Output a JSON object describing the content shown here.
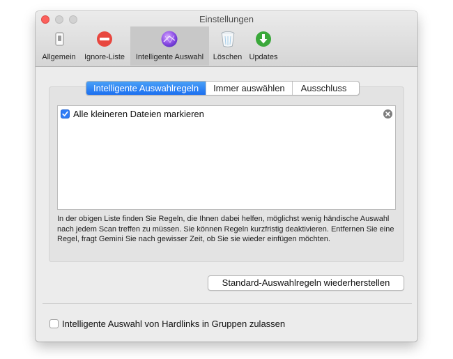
{
  "window": {
    "title": "Einstellungen"
  },
  "toolbar": {
    "items": [
      {
        "label": "Allgemein",
        "icon": "switch-icon"
      },
      {
        "label": "Ignore-Liste",
        "icon": "no-entry-icon"
      },
      {
        "label": "Intelligente Auswahl",
        "icon": "smart-selection-icon",
        "selected": true
      },
      {
        "label": "Löschen",
        "icon": "trash-icon"
      },
      {
        "label": "Updates",
        "icon": "download-icon"
      }
    ]
  },
  "tabs": [
    {
      "label": "Intelligente Auswahlregeln",
      "active": true
    },
    {
      "label": "Immer auswählen",
      "active": false
    },
    {
      "label": "Ausschluss",
      "active": false
    }
  ],
  "rules": [
    {
      "label": "Alle kleineren Dateien markieren",
      "checked": true
    }
  ],
  "description": "In der obigen Liste finden Sie Regeln, die Ihnen dabei helfen, möglichst wenig händische Auswahl nach jedem Scan treffen zu müssen. Sie können Regeln kurzfristig deaktivieren. Entfernen Sie eine Regel, fragt Gemini Sie nach gewisser Zeit, ob Sie sie wieder einfügen möchten.",
  "restore_button": "Standard-Auswahlregeln wiederherstellen",
  "hardlinks_option": {
    "label": "Intelligente Auswahl von Hardlinks in Gruppen zulassen",
    "checked": false
  },
  "colors": {
    "accent": "#1b6ff0",
    "close_button": "#fc605c",
    "ignore_icon": "#e8473f",
    "updates_icon": "#3aa83a"
  }
}
